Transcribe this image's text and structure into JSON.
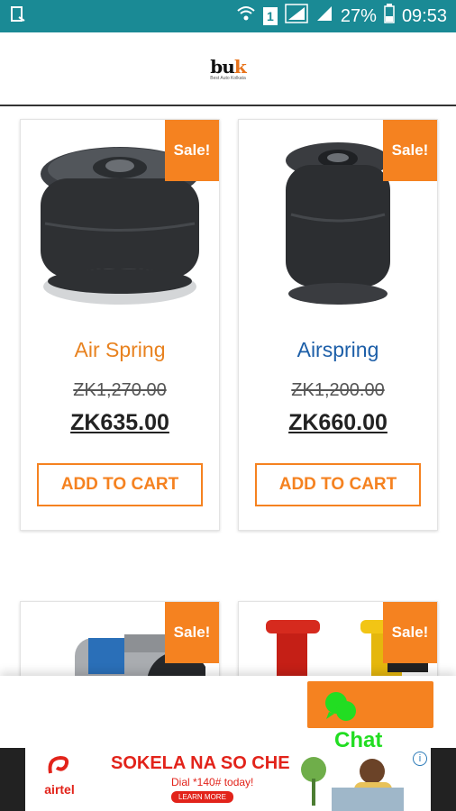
{
  "status_bar": {
    "battery": "27%",
    "time": "09:53",
    "sim_slot": "1",
    "icons": [
      "screenshot-icon",
      "wifi-icon",
      "sim-icon",
      "signal-icon",
      "signal-icon",
      "battery-icon"
    ]
  },
  "header": {
    "logo_mark_a": "bu",
    "logo_mark_b": "k",
    "logo_sub": "Best Auto Kolkata"
  },
  "products": [
    {
      "name": "Air Spring",
      "badge": "Sale!",
      "old_price": "ZK1,270.00",
      "price": "ZK635.00",
      "button": "ADD TO CART",
      "name_color": "#e8821f"
    },
    {
      "name": "Airspring",
      "badge": "Sale!",
      "old_price": "ZK1,200.00",
      "price": "ZK660.00",
      "button": "ADD TO CART",
      "name_color": "#1d5fa8"
    },
    {
      "badge": "Sale!"
    },
    {
      "badge": "Sale!"
    }
  ],
  "chat": {
    "label": "Chat",
    "icon": "chat-bubble-icon"
  },
  "ad": {
    "brand": "airtel",
    "headline": "SOKELA NA SO CHE",
    "subline": "Dial *140# today!",
    "cta": "LEARN MORE",
    "info": "i"
  },
  "colors": {
    "status_bar": "#1a8a95",
    "accent": "#f58220",
    "chat_text": "#22dd22",
    "ad_red": "#e2231a"
  }
}
